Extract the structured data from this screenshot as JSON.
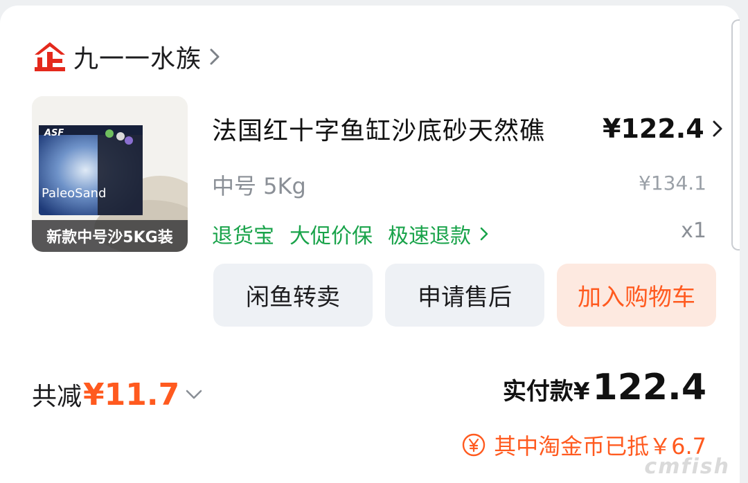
{
  "shop": {
    "name": "九一一水族",
    "badge_icon": "tmall-enterprise-icon",
    "badge_color": "#e4291c"
  },
  "product": {
    "title": "法国红十字鱼缸沙底砂天然礁",
    "price": "¥122.4",
    "variant": "中号 5Kg",
    "original_price": "¥134.1",
    "quantity": "x1",
    "image_caption": "新款中号沙5KG装",
    "image_brand_text": "ASF",
    "image_product_text": "PaleoSand"
  },
  "services": {
    "items": [
      "退货宝",
      "大促价保",
      "极速退款"
    ],
    "color": "#19a34a"
  },
  "actions": {
    "resale": "闲鱼转卖",
    "after_sales": "申请售后",
    "add_to_cart": "加入购物车",
    "accent_color": "#ff5a1f"
  },
  "summary": {
    "discount_label": "共减",
    "discount_value": "¥11.7",
    "paid_label": "实付款¥",
    "paid_value": "122.4",
    "coins_text": "其中淘金币已抵￥6.7"
  },
  "watermark": "cmfish"
}
